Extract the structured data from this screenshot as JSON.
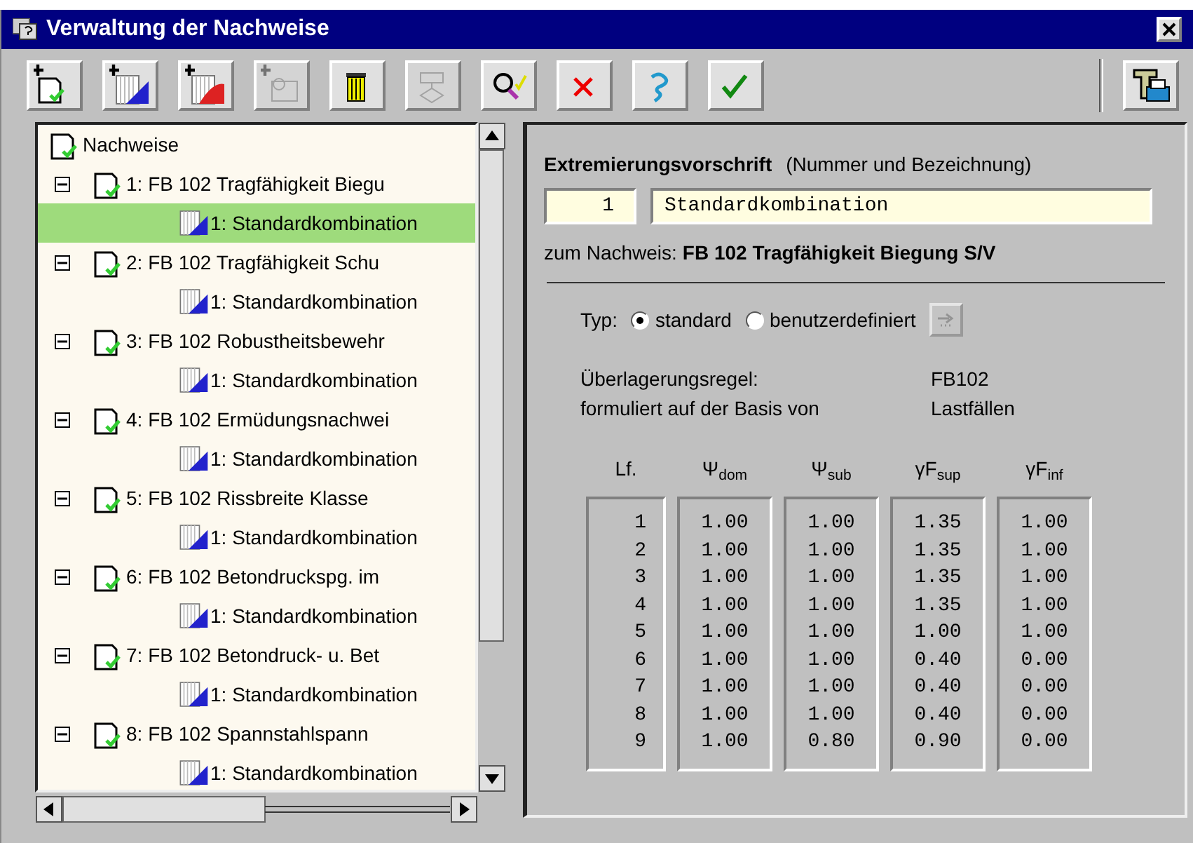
{
  "window": {
    "title": "Verwaltung der Nachweise"
  },
  "toolbar": {
    "left": [
      {
        "kind": "new-proof",
        "disabled": false
      },
      {
        "kind": "new-combination-blue",
        "disabled": false
      },
      {
        "kind": "new-combination-red",
        "disabled": false
      },
      {
        "kind": "new-special",
        "disabled": true
      },
      {
        "kind": "delete",
        "disabled": false
      },
      {
        "kind": "flow",
        "disabled": true
      },
      {
        "kind": "inspect",
        "disabled": false
      },
      {
        "kind": "cancel",
        "disabled": false
      },
      {
        "kind": "help",
        "disabled": false
      },
      {
        "kind": "ok",
        "disabled": false
      }
    ],
    "right": [
      {
        "kind": "print",
        "disabled": false
      }
    ]
  },
  "tree": {
    "label": "Nachweise",
    "children": [
      {
        "label": "1: FB 102 Tragfähigkeit Biegu",
        "expanded": true,
        "children": [
          {
            "label": "1: Standardkombination",
            "selected": true
          }
        ]
      },
      {
        "label": "2: FB 102 Tragfähigkeit Schu",
        "expanded": true,
        "children": [
          {
            "label": "1: Standardkombination",
            "selected": false
          }
        ]
      },
      {
        "label": "3: FB 102 Robustheitsbewehr",
        "expanded": true,
        "children": [
          {
            "label": "1: Standardkombination",
            "selected": false
          }
        ]
      },
      {
        "label": "4: FB 102 Ermüdungsnachwei",
        "expanded": true,
        "children": [
          {
            "label": "1: Standardkombination",
            "selected": false
          }
        ]
      },
      {
        "label": "5: FB 102 Rissbreite Klasse",
        "expanded": true,
        "children": [
          {
            "label": "1: Standardkombination",
            "selected": false
          }
        ]
      },
      {
        "label": "6: FB 102 Betondruckspg. im",
        "expanded": true,
        "children": [
          {
            "label": "1: Standardkombination",
            "selected": false
          }
        ]
      },
      {
        "label": "7: FB 102 Betondruck- u. Bet",
        "expanded": true,
        "children": [
          {
            "label": "1: Standardkombination",
            "selected": false
          }
        ]
      },
      {
        "label": "8: FB 102 Spannstahlspann",
        "expanded": true,
        "children": [
          {
            "label": "1: Standardkombination",
            "selected": false
          }
        ]
      }
    ]
  },
  "detail": {
    "heading": "Extremierungsvorschrift",
    "heading_note": "(Nummer und Bezeichnung)",
    "number": "1",
    "name": "Standardkombination",
    "proof_label": "zum Nachweis:",
    "proof_name": "FB 102 Tragfähigkeit Biegung S/V",
    "type_label": "Typ:",
    "type_options": [
      {
        "label": "standard",
        "selected": true
      },
      {
        "label": "benutzerdefiniert",
        "selected": false
      }
    ],
    "edit_button": {
      "disabled": true
    },
    "info": [
      {
        "label": "Überlagerungsregel:",
        "value": "FB102"
      },
      {
        "label": "formuliert auf der Basis von",
        "value": "Lastfällen"
      }
    ],
    "table": {
      "columns": [
        {
          "header": "Lf.",
          "values": [
            "1",
            "2",
            "3",
            "4",
            "5",
            "6",
            "7",
            "8",
            "9"
          ]
        },
        {
          "header": "Ψ$_{dom}$",
          "values": [
            "1.00",
            "1.00",
            "1.00",
            "1.00",
            "1.00",
            "1.00",
            "1.00",
            "1.00",
            "1.00"
          ]
        },
        {
          "header": "Ψ$_{sub}$",
          "values": [
            "1.00",
            "1.00",
            "1.00",
            "1.00",
            "1.00",
            "1.00",
            "1.00",
            "1.00",
            "0.80"
          ]
        },
        {
          "header": "γF$_{sup}$",
          "values": [
            "1.35",
            "1.35",
            "1.35",
            "1.35",
            "1.00",
            "0.40",
            "0.40",
            "0.40",
            "0.90"
          ]
        },
        {
          "header": "γF$_{inf}$",
          "values": [
            "1.00",
            "1.00",
            "1.00",
            "1.00",
            "1.00",
            "0.00",
            "0.00",
            "0.00",
            "0.00"
          ]
        }
      ]
    }
  }
}
